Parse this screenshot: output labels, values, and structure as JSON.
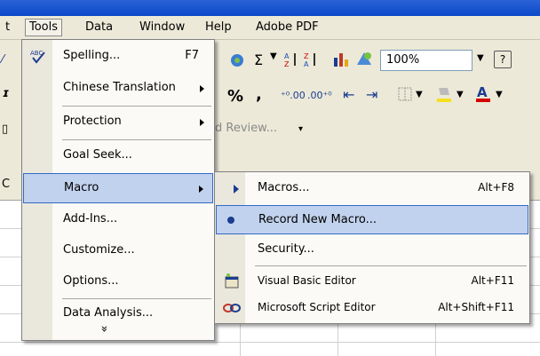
{
  "menubar": {
    "items": [
      {
        "label": "t"
      },
      {
        "label": "Tools"
      },
      {
        "label": "Data"
      },
      {
        "label": "Window"
      },
      {
        "label": "Help"
      },
      {
        "label": "Adobe PDF"
      }
    ]
  },
  "toolbar": {
    "zoom": "100%",
    "percent": "%",
    "comma": ",",
    "review_label": "d Review...",
    "sum_symbol": "Σ"
  },
  "tools_menu": {
    "items": [
      {
        "label": "Spelling...",
        "shortcut": "F7"
      },
      {
        "label": "Chinese Translation"
      },
      {
        "label": "Protection"
      },
      {
        "label": "Goal Seek..."
      },
      {
        "label": "Macro"
      },
      {
        "label": "Add-Ins..."
      },
      {
        "label": "Customize..."
      },
      {
        "label": "Options..."
      },
      {
        "label": "Data Analysis..."
      }
    ],
    "expand": "»"
  },
  "macro_menu": {
    "items": [
      {
        "label": "Macros...",
        "shortcut": "Alt+F8"
      },
      {
        "label": "Record New Macro..."
      },
      {
        "label": "Security..."
      },
      {
        "label": "Visual Basic Editor",
        "shortcut": "Alt+F11"
      },
      {
        "label": "Microsoft Script Editor",
        "shortcut": "Alt+Shift+F11"
      }
    ]
  },
  "sheet": {
    "col_label": "C"
  }
}
